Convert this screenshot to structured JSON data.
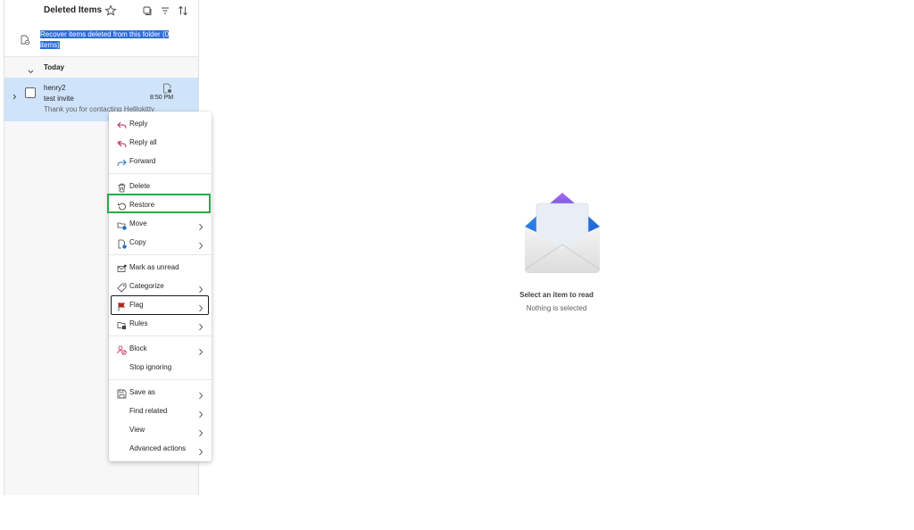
{
  "list": {
    "folder_title": "Deleted Items",
    "recover_text": "Recover items deleted from this folder (0 items)",
    "group_label": "Today",
    "message": {
      "sender": "henry2",
      "subject": "test invite",
      "preview": "Thank you for contacting Helllokitty",
      "time": "8:50 PM"
    }
  },
  "reading": {
    "empty_title": "Select an item to read",
    "empty_subtitle": "Nothing is selected"
  },
  "context_menu": {
    "reply": "Reply",
    "reply_all": "Reply all",
    "forward": "Forward",
    "delete": "Delete",
    "restore": "Restore",
    "move": "Move",
    "copy": "Copy",
    "mark_unread": "Mark as unread",
    "categorize": "Categorize",
    "flag": "Flag",
    "rules": "Rules",
    "block": "Block",
    "stop_ignoring": "Stop ignoring",
    "save_as": "Save as",
    "find_related": "Find related",
    "view": "View",
    "advanced_actions": "Advanced actions"
  },
  "colors": {
    "accent_blue": "#2e6dd9",
    "selected_row": "#cfe3fa",
    "reply_pink": "#c2185b",
    "forward_blue": "#1a6fc9",
    "flag_red": "#b3261e",
    "restore_highlight": "#2aa847"
  },
  "icons": {
    "favorite": "star-icon",
    "select_mode": "checklist-icon",
    "filter": "filter-icon",
    "sort": "sort-icon",
    "recover": "recover-icon",
    "expand": "chevron-right-icon",
    "collapse": "chevron-down-icon"
  }
}
